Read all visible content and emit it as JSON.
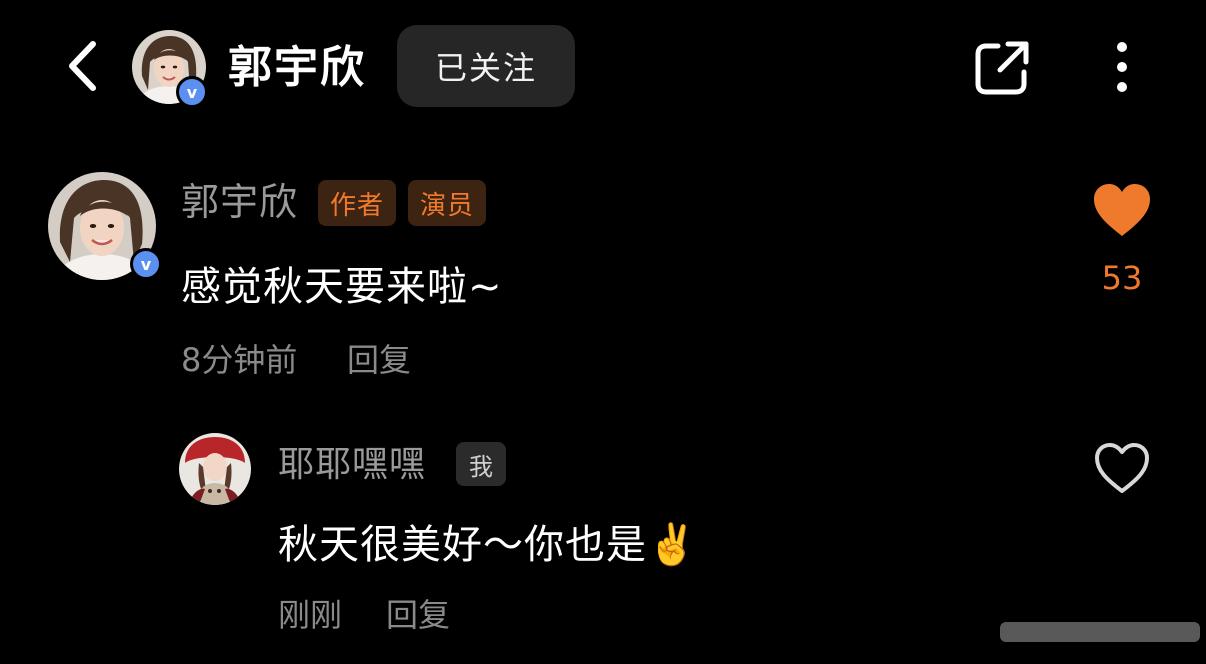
{
  "header": {
    "back_icon": "chevron-left-icon",
    "name": "郭宇欣",
    "verified_badge": "v",
    "follow_label": "已关注",
    "share_icon": "share-external-icon",
    "more_icon": "more-vertical-icon"
  },
  "comments": [
    {
      "name": "郭宇欣",
      "verified_badge": "v",
      "tags": [
        "作者",
        "演员"
      ],
      "text": "感觉秋天要来啦~",
      "time": "8分钟前",
      "reply_label": "回复",
      "like_count": "53",
      "liked": true
    },
    {
      "name": "耶耶嘿嘿",
      "tag": "我",
      "text": "秋天很美好～你也是",
      "emoji": "✌️",
      "time": "刚刚",
      "reply_label": "回复",
      "liked": false
    }
  ],
  "colors": {
    "background": "#000000",
    "accent_orange": "#f07a2c",
    "tag_bg": "#3d2312",
    "follow_bg": "#262626",
    "verify_blue": "#5b8ff0",
    "muted_text": "#8a8a8a"
  }
}
